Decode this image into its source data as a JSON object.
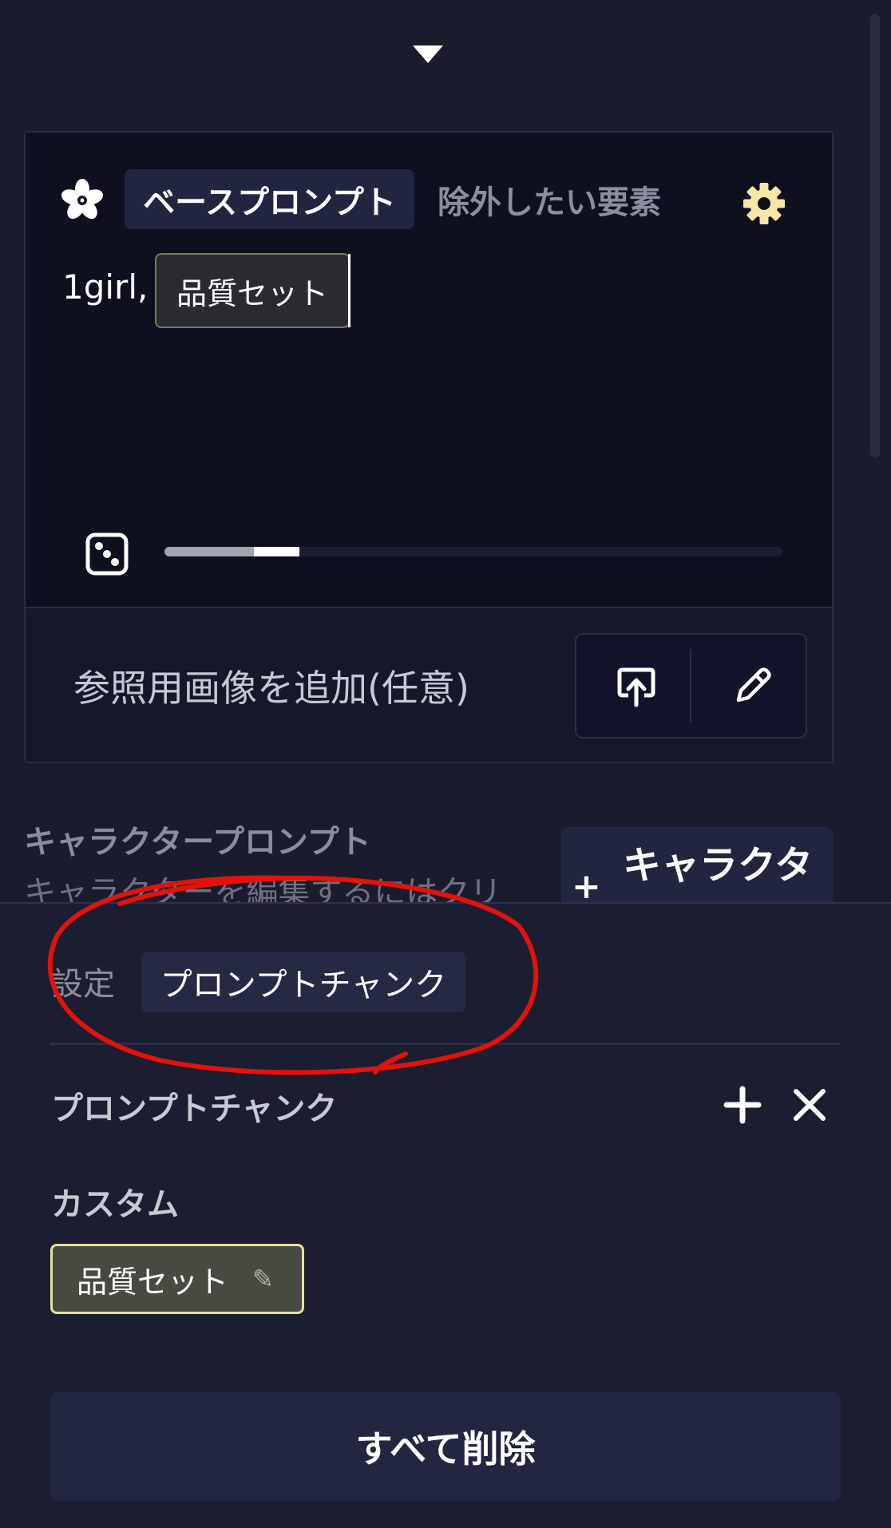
{
  "prompt_panel": {
    "tabs": {
      "base": "ベースプロンプト",
      "negative": "除外したい要素"
    },
    "prompt_text": "1girl,",
    "chip_label": "品質セット",
    "seed_progress": {
      "primary": 0.14,
      "secondary": 0.22
    },
    "reference_label": "参照用画像を追加(任意)"
  },
  "character_section": {
    "title": "キャラクタープロンプト",
    "subtitle": "キャラクターを編集するにはクリ",
    "add_plus": "+",
    "add_label": "キャラクタ"
  },
  "bottom_sheet": {
    "tabs": {
      "settings": "設定",
      "prompt_chunk": "プロンプトチャンク"
    },
    "chunk_title": "プロンプトチャンク",
    "custom_title": "カスタム",
    "chunk_chip": {
      "label": "品質セット",
      "edit_glyph": "✎"
    },
    "delete_all": "すべて削除"
  },
  "colors": {
    "background": "#1a1c2e",
    "editor": "#0e0f1f",
    "accent_gear": "#f5e7a8",
    "chip_border": "#e6e39a",
    "annotation_red": "#e3120b"
  }
}
